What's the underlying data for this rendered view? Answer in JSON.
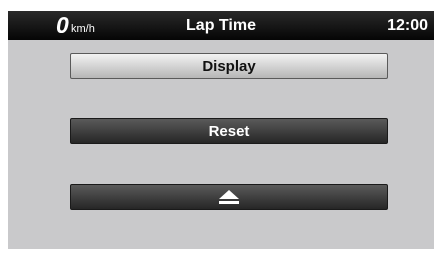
{
  "status_bar": {
    "speed_value": "0",
    "speed_unit": "km/h",
    "title": "Lap Time",
    "clock": "12:00"
  },
  "menu": {
    "display_label": "Display",
    "reset_label": "Reset",
    "eject_icon": "eject-icon"
  },
  "colors": {
    "screen_background": "#c9c9cb",
    "status_bar": "#0d0d0d",
    "selected_button": "#e0e0e0",
    "dark_button": "#3c3c3c"
  }
}
